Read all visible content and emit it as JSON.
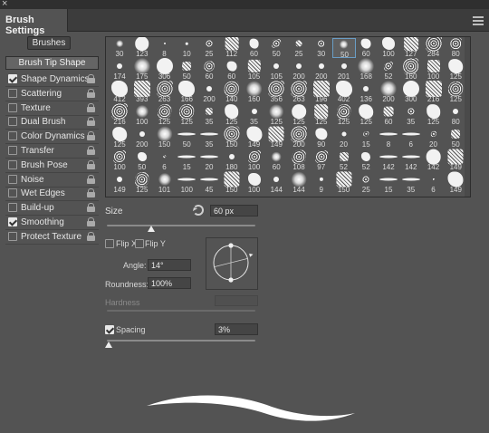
{
  "window": {
    "close_glyph": "×"
  },
  "panel": {
    "tab_title": "Brush Settings",
    "menu_icon": "hamburger-menu-icon"
  },
  "sidebar": {
    "brushes_button": "Brushes",
    "brush_tip_shape": "Brush Tip Shape",
    "items": [
      {
        "label": "Shape Dynamics",
        "checked": true
      },
      {
        "label": "Scattering",
        "checked": false
      },
      {
        "label": "Texture",
        "checked": false
      },
      {
        "label": "Dual Brush",
        "checked": false
      },
      {
        "label": "Color Dynamics",
        "checked": false
      },
      {
        "label": "Transfer",
        "checked": false
      },
      {
        "label": "Brush Pose",
        "checked": false
      },
      {
        "label": "Noise",
        "checked": false
      },
      {
        "label": "Wet Edges",
        "checked": false
      },
      {
        "label": "Build-up",
        "checked": false
      },
      {
        "label": "Smoothing",
        "checked": true
      },
      {
        "label": "Protect Texture",
        "checked": false
      }
    ]
  },
  "brush_grid": {
    "selected_index": 10,
    "sizes": [
      "30",
      "123",
      "8",
      "10",
      "25",
      "112",
      "60",
      "50",
      "25",
      "30",
      "50",
      "60",
      "100",
      "127",
      "284",
      "80",
      "174",
      "175",
      "306",
      "50",
      "60",
      "60",
      "105",
      "105",
      "200",
      "200",
      "201",
      "168",
      "52",
      "160",
      "100",
      "125",
      "412",
      "393",
      "263",
      "166",
      "200",
      "140",
      "160",
      "356",
      "263",
      "196",
      "402",
      "136",
      "200",
      "300",
      "216",
      "125",
      "216",
      "100",
      "125",
      "125",
      "35",
      "125",
      "35",
      "125",
      "125",
      "125",
      "125",
      "125",
      "60",
      "35",
      "125",
      "80",
      "125",
      "200",
      "150",
      "50",
      "35",
      "150",
      "149",
      "149",
      "200",
      "90",
      "20",
      "15",
      "8",
      "6",
      "20",
      "50",
      "100",
      "50",
      "6",
      "15",
      "20",
      "180",
      "100",
      "60",
      "108",
      "97",
      "52",
      "52",
      "142",
      "142",
      "142",
      "149",
      "149",
      "125",
      "101",
      "100",
      "45",
      "150",
      "100",
      "144",
      "144",
      "9",
      "150",
      "25",
      "15",
      "35",
      "6",
      "149"
    ]
  },
  "tip": {
    "size_label": "Size",
    "size_value": "60 px",
    "size_slider_fraction": 0.3,
    "flip_x_label": "Flip X",
    "flip_y_label": "Flip Y",
    "angle_label": "Angle:",
    "angle_value": "14°",
    "roundness_label": "Roundness:",
    "roundness_value": "100%",
    "hardness_label": "Hardness",
    "spacing_label": "Spacing",
    "spacing_checked": true,
    "spacing_value": "3%",
    "spacing_slider_fraction": 0.01
  }
}
